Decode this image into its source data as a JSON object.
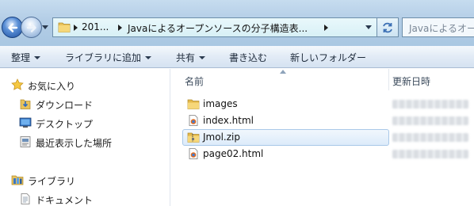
{
  "address_bar": {
    "breadcrumbs": [
      "201...",
      "Javaによるオープンソースの分子構造表..."
    ],
    "search_placeholder": "Javaによるオープ"
  },
  "toolbar": {
    "organize": "整理",
    "add_to_library": "ライブラリに追加",
    "share": "共有",
    "burn": "書き込む",
    "new_folder": "新しいフォルダー"
  },
  "nav": {
    "favorites": "お気に入り",
    "favorites_items": [
      "ダウンロード",
      "デスクトップ",
      "最近表示した場所"
    ],
    "libraries": "ライブラリ",
    "libraries_items": [
      "ドキュメント"
    ]
  },
  "filelist": {
    "col_name": "名前",
    "col_date": "更新日時",
    "files": [
      {
        "name": "images",
        "type": "folder-icon",
        "selected": false
      },
      {
        "name": "index.html",
        "type": "html-file-icon",
        "selected": false
      },
      {
        "name": "Jmol.zip",
        "type": "zip-file-icon",
        "selected": true
      },
      {
        "name": "page02.html",
        "type": "html-file-icon",
        "selected": false
      }
    ]
  },
  "colors": {
    "selection_border": "#a9c8e8",
    "toolbar_bg": "#dce8f5",
    "address_bg": "#d8f0f6"
  }
}
